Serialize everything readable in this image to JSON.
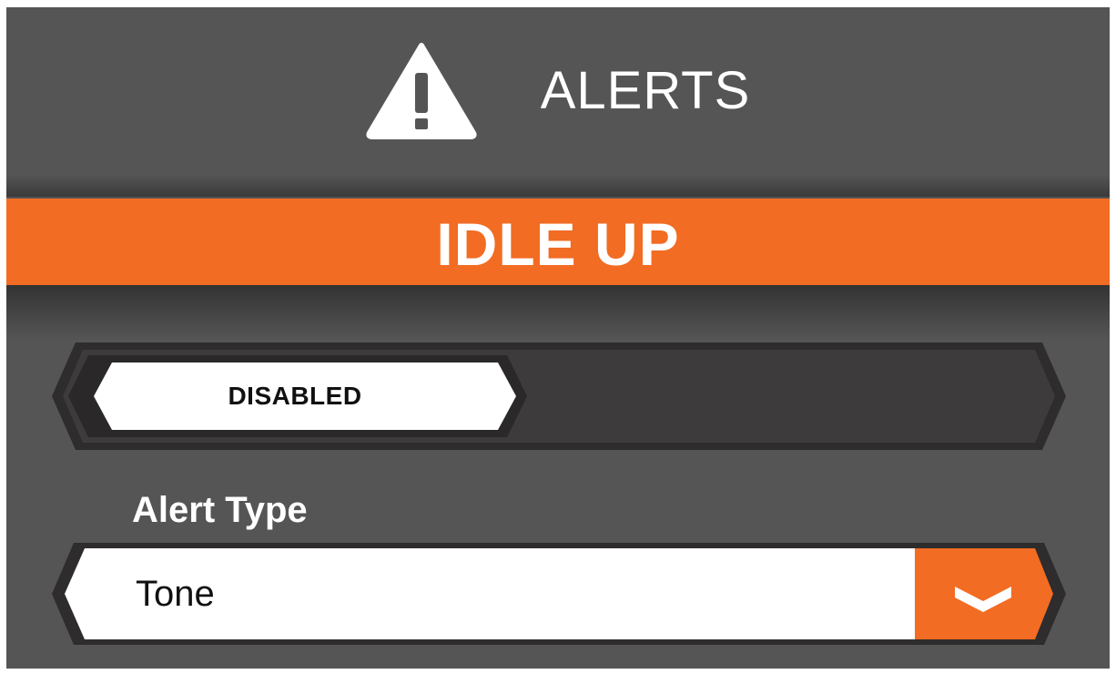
{
  "header": {
    "icon": "warning-icon",
    "title": "ALERTS"
  },
  "title_bar": {
    "label": "IDLE UP"
  },
  "enable_toggle": {
    "state_label": "DISABLED"
  },
  "alert_type": {
    "label": "Alert Type",
    "selected": "Tone",
    "dropdown_icon": "chevron-down-icon"
  },
  "colors": {
    "background": "#555555",
    "accent": "#f26c23",
    "track": "#3d3b3c",
    "text_light": "#ffffff",
    "text_dark": "#111111"
  }
}
